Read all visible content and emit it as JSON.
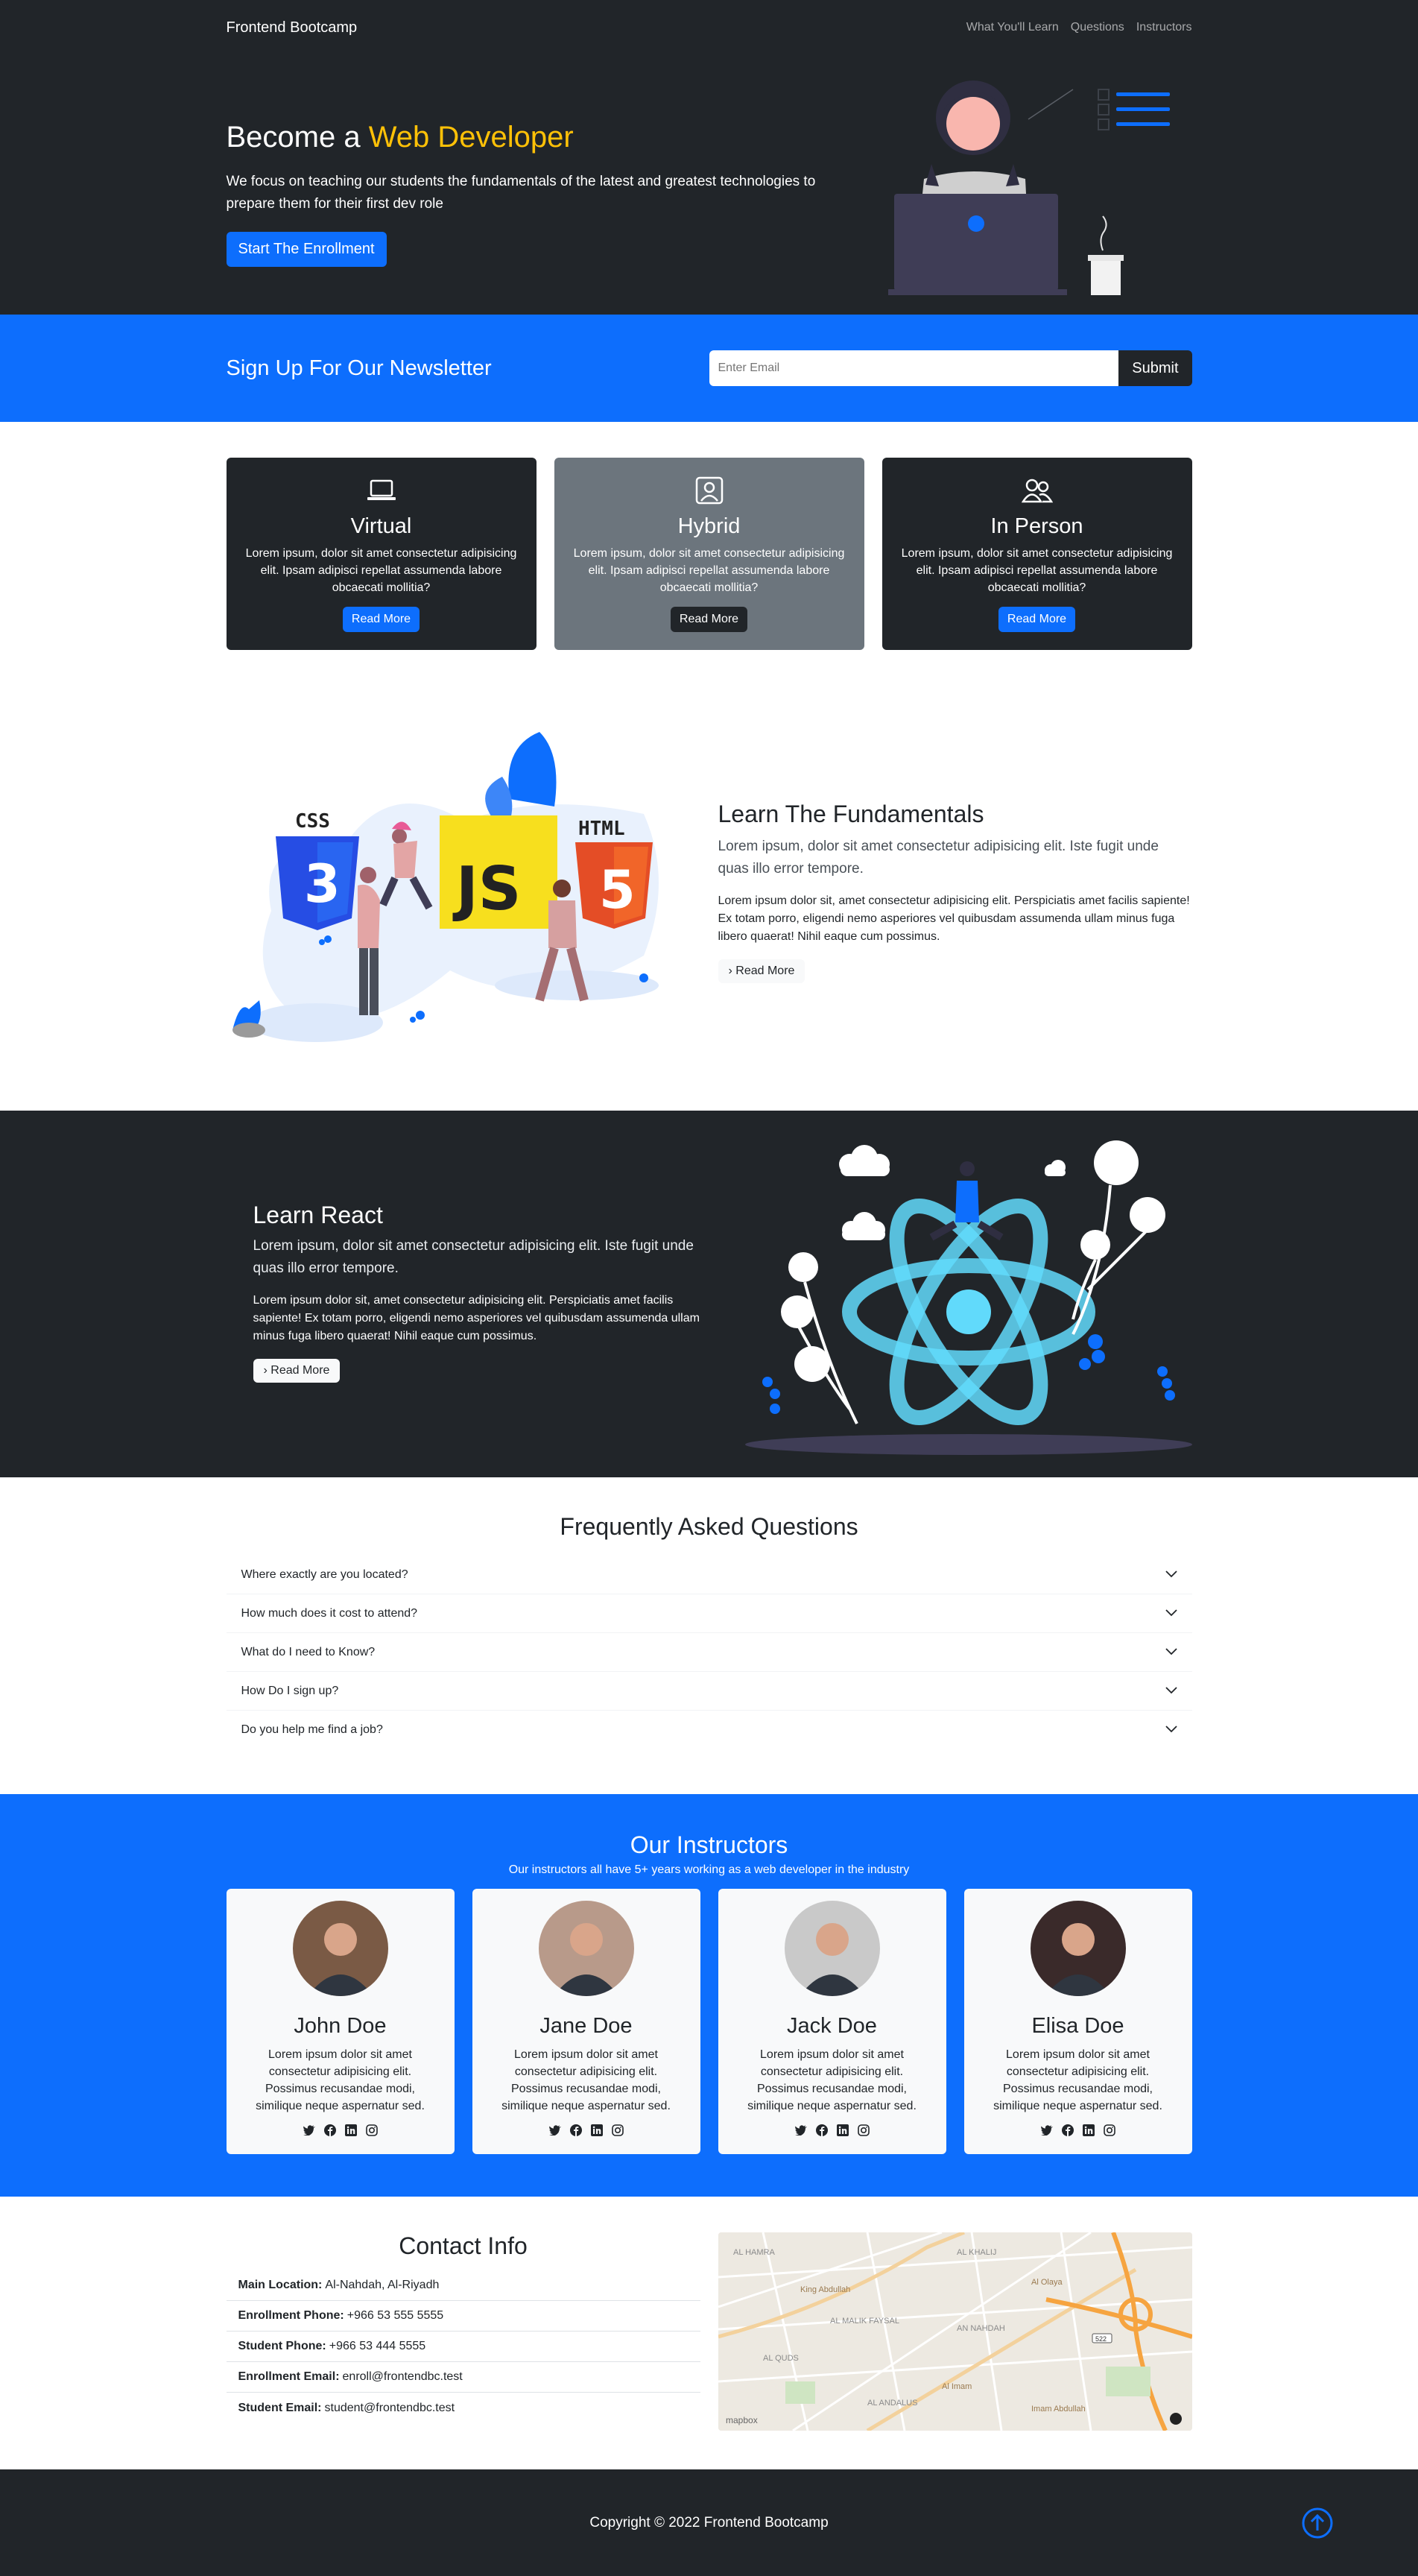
{
  "nav": {
    "brand": "Frontend Bootcamp",
    "links": [
      "What You'll Learn",
      "Questions",
      "Instructors"
    ]
  },
  "hero": {
    "title_prefix": "Become a",
    "title_accent": "Web Developer",
    "lead": "We focus on teaching our students the fundamentals of the latest and greatest technologies to prepare them for their first dev role",
    "button": "Start The Enrollment"
  },
  "newsletter": {
    "title": "Sign Up For Our Newsletter",
    "placeholder": "Enter Email",
    "button": "Submit"
  },
  "boxes": [
    {
      "title": "Virtual",
      "text": "Lorem ipsum, dolor sit amet consectetur adipisicing elit. Ipsam adipisci repellat assumenda labore obcaecati mollitia?",
      "button": "Read More",
      "icon": "laptop-icon"
    },
    {
      "title": "Hybrid",
      "text": "Lorem ipsum, dolor sit amet consectetur adipisicing elit. Ipsam adipisci repellat assumenda labore obcaecati mollitia?",
      "button": "Read More",
      "icon": "person-square-icon"
    },
    {
      "title": "In Person",
      "text": "Lorem ipsum, dolor sit amet consectetur adipisicing elit. Ipsam adipisci repellat assumenda labore obcaecati mollitia?",
      "button": "Read More",
      "icon": "people-icon"
    }
  ],
  "fundamentals": {
    "title": "Learn The Fundamentals",
    "lead": "Lorem ipsum, dolor sit amet consectetur adipisicing elit. Iste fugit unde quas illo error tempore.",
    "body": "Lorem ipsum dolor sit, amet consectetur adipisicing elit. Perspiciatis amet facilis sapiente! Ex totam porro, eligendi nemo asperiores vel quibusdam assumenda ullam minus fuga libero quaerat! Nihil eaque cum possimus.",
    "button": "Read More",
    "illus_labels": {
      "css": "CSS",
      "js": "JS",
      "html": "HTML"
    }
  },
  "react": {
    "title": "Learn React",
    "lead": "Lorem ipsum, dolor sit amet consectetur adipisicing elit. Iste fugit unde quas illo error tempore.",
    "body": "Lorem ipsum dolor sit, amet consectetur adipisicing elit. Perspiciatis amet facilis sapiente! Ex totam porro, eligendi nemo asperiores vel quibusdam assumenda ullam minus fuga libero quaerat! Nihil eaque cum possimus.",
    "button": "Read More"
  },
  "faq": {
    "title": "Frequently Asked Questions",
    "items": [
      "Where exactly are you located?",
      "How much does it cost to attend?",
      "What do I need to Know?",
      "How Do I sign up?",
      "Do you help me find a job?"
    ]
  },
  "instructors": {
    "title": "Our Instructors",
    "subtitle": "Our instructors all have 5+ years working as a web developer in the industry",
    "people": [
      {
        "name": "John Doe",
        "bio": "Lorem ipsum dolor sit amet consectetur adipisicing elit. Possimus recusandae modi, similique neque aspernatur sed.",
        "photo_bg": "#7a5a45"
      },
      {
        "name": "Jane Doe",
        "bio": "Lorem ipsum dolor sit amet consectetur adipisicing elit. Possimus recusandae modi, similique neque aspernatur sed.",
        "photo_bg": "#b89a8a"
      },
      {
        "name": "Jack Doe",
        "bio": "Lorem ipsum dolor sit amet consectetur adipisicing elit. Possimus recusandae modi, similique neque aspernatur sed.",
        "photo_bg": "#c9c9c9"
      },
      {
        "name": "Elisa Doe",
        "bio": "Lorem ipsum dolor sit amet consectetur adipisicing elit. Possimus recusandae modi, similique neque aspernatur sed.",
        "photo_bg": "#3a2a2a"
      }
    ],
    "social_icons": [
      "twitter-icon",
      "facebook-icon",
      "linkedin-icon",
      "instagram-icon"
    ]
  },
  "contact": {
    "title": "Contact Info",
    "rows": [
      {
        "label": "Main Location:",
        "value": "Al-Nahdah, Al-Riyadh"
      },
      {
        "label": "Enrollment Phone:",
        "value": "+966 53 555 5555"
      },
      {
        "label": "Student Phone:",
        "value": "+966 53 444 5555"
      },
      {
        "label": "Enrollment Email:",
        "value": "enroll@frontendbc.test"
      },
      {
        "label": "Student Email:",
        "value": "student@frontendbc.test"
      }
    ],
    "map": {
      "labels": [
        "AL HAMRA",
        "AL KHALIJ",
        "AL MALIK FAYSAL",
        "AN NAHDAH",
        "AL QUDS",
        "AL ANDALUS",
        "King Abdullah",
        "Al Olaya",
        "Al Imam",
        "Imam Abdullah"
      ],
      "logo": "mapbox",
      "road_badge": "522"
    }
  },
  "footer": {
    "copyright": "Copyright © 2022 Frontend Bootcamp"
  },
  "colors": {
    "primary": "#0d6efd",
    "dark": "#212529",
    "accent": "#ffc107",
    "gray": "#6c757d"
  }
}
